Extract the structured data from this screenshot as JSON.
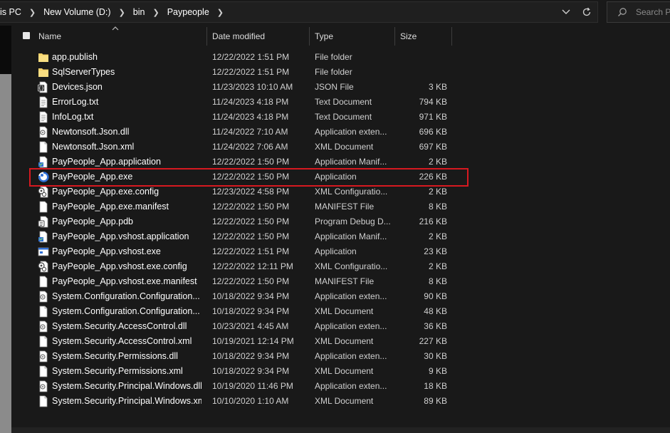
{
  "address_bar": {
    "crumbs": [
      "is PC",
      "New Volume (D:)",
      "bin",
      "Paypeople"
    ],
    "search_placeholder": "Search Pa"
  },
  "columns": {
    "name": "Name",
    "date_modified": "Date modified",
    "type": "Type",
    "size": "Size"
  },
  "files": [
    {
      "name": "app.publish",
      "date": "12/22/2022 1:51 PM",
      "type": "File folder",
      "size": "",
      "icon": "folder-icon"
    },
    {
      "name": "SqlServerTypes",
      "date": "12/22/2022 1:51 PM",
      "type": "File folder",
      "size": "",
      "icon": "folder-icon"
    },
    {
      "name": "Devices.json",
      "date": "11/23/2023 10:10 AM",
      "type": "JSON File",
      "size": "3 KB",
      "icon": "json-file-icon"
    },
    {
      "name": "ErrorLog.txt",
      "date": "11/24/2023 4:18 PM",
      "type": "Text Document",
      "size": "794 KB",
      "icon": "text-file-icon"
    },
    {
      "name": "InfoLog.txt",
      "date": "11/24/2023 4:18 PM",
      "type": "Text Document",
      "size": "971 KB",
      "icon": "text-file-icon"
    },
    {
      "name": "Newtonsoft.Json.dll",
      "date": "11/24/2022 7:10 AM",
      "type": "Application exten...",
      "size": "696 KB",
      "icon": "dll-file-icon"
    },
    {
      "name": "Newtonsoft.Json.xml",
      "date": "11/24/2022 7:06 AM",
      "type": "XML Document",
      "size": "697 KB",
      "icon": "xml-file-icon"
    },
    {
      "name": "PayPeople_App.application",
      "date": "12/22/2022 1:50 PM",
      "type": "Application Manif...",
      "size": "2 KB",
      "icon": "application-manifest-icon"
    },
    {
      "name": "PayPeople_App.exe",
      "date": "12/22/2022 1:50 PM",
      "type": "Application",
      "size": "226 KB",
      "icon": "paypeople-app-icon"
    },
    {
      "name": "PayPeople_App.exe.config",
      "date": "12/23/2022 4:58 PM",
      "type": "XML Configuratio...",
      "size": "2 KB",
      "icon": "config-file-icon"
    },
    {
      "name": "PayPeople_App.exe.manifest",
      "date": "12/22/2022 1:50 PM",
      "type": "MANIFEST File",
      "size": "8 KB",
      "icon": "manifest-file-icon"
    },
    {
      "name": "PayPeople_App.pdb",
      "date": "12/22/2022 1:50 PM",
      "type": "Program Debug D...",
      "size": "216 KB",
      "icon": "pdb-file-icon"
    },
    {
      "name": "PayPeople_App.vshost.application",
      "date": "12/22/2022 1:50 PM",
      "type": "Application Manif...",
      "size": "2 KB",
      "icon": "application-manifest-icon"
    },
    {
      "name": "PayPeople_App.vshost.exe",
      "date": "12/22/2022 1:51 PM",
      "type": "Application",
      "size": "23 KB",
      "icon": "exe-window-icon"
    },
    {
      "name": "PayPeople_App.vshost.exe.config",
      "date": "12/22/2022 12:11 PM",
      "type": "XML Configuratio...",
      "size": "2 KB",
      "icon": "config-file-icon"
    },
    {
      "name": "PayPeople_App.vshost.exe.manifest",
      "date": "12/22/2022 1:50 PM",
      "type": "MANIFEST File",
      "size": "8 KB",
      "icon": "manifest-file-icon"
    },
    {
      "name": "System.Configuration.Configuration...",
      "date": "10/18/2022 9:34 PM",
      "type": "Application exten...",
      "size": "90 KB",
      "icon": "dll-file-icon"
    },
    {
      "name": "System.Configuration.Configuration...",
      "date": "10/18/2022 9:34 PM",
      "type": "XML Document",
      "size": "48 KB",
      "icon": "xml-file-icon"
    },
    {
      "name": "System.Security.AccessControl.dll",
      "date": "10/23/2021 4:45 AM",
      "type": "Application exten...",
      "size": "36 KB",
      "icon": "dll-file-icon"
    },
    {
      "name": "System.Security.AccessControl.xml",
      "date": "10/19/2021 12:14 PM",
      "type": "XML Document",
      "size": "227 KB",
      "icon": "xml-file-icon"
    },
    {
      "name": "System.Security.Permissions.dll",
      "date": "10/18/2022 9:34 PM",
      "type": "Application exten...",
      "size": "30 KB",
      "icon": "dll-file-icon"
    },
    {
      "name": "System.Security.Permissions.xml",
      "date": "10/18/2022 9:34 PM",
      "type": "XML Document",
      "size": "9 KB",
      "icon": "xml-file-icon"
    },
    {
      "name": "System.Security.Principal.Windows.dll",
      "date": "10/19/2020 11:46 PM",
      "type": "Application exten...",
      "size": "18 KB",
      "icon": "dll-file-icon"
    },
    {
      "name": "System.Security.Principal.Windows.xml",
      "date": "10/10/2020 1:10 AM",
      "type": "XML Document",
      "size": "89 KB",
      "icon": "xml-file-icon"
    }
  ],
  "highlighted_file": "PayPeople_App.exe",
  "colors": {
    "background": "#191919",
    "highlight_border": "#d71920",
    "folder": "#f7d36b",
    "app_icon_blue": "#2f6fd6"
  }
}
